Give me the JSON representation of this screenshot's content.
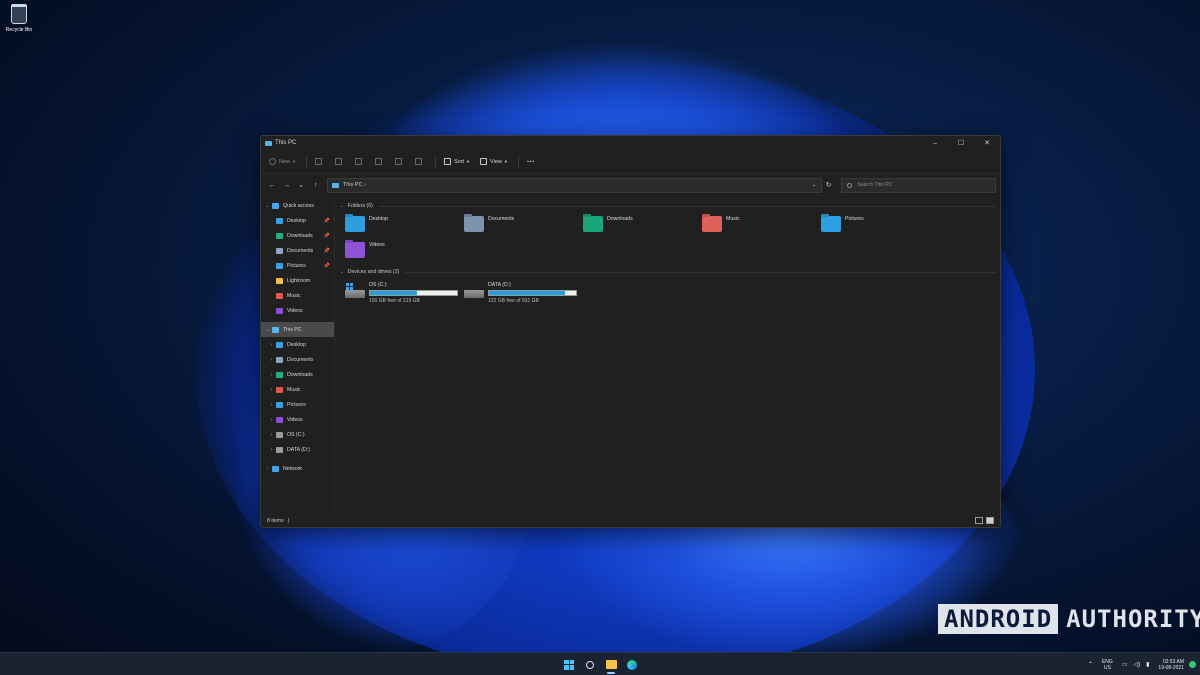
{
  "desktop": {
    "recycle_bin_label": "Recycle Bin",
    "watermark": {
      "part1": "ANDROID",
      "part2": "AUTHORITY"
    }
  },
  "window": {
    "title": "This PC",
    "controls": {
      "minimize": "–",
      "maximize": "☐",
      "close": "✕"
    }
  },
  "toolbar": {
    "new_label": "New",
    "sort_label": "Sort",
    "view_label": "View",
    "more_label": "···"
  },
  "address": {
    "back": "←",
    "forward": "→",
    "recent": "⌄",
    "up": "↑",
    "crumb": "This PC  ›",
    "dropdown": "⌄",
    "refresh": "↻",
    "search_placeholder": "Search This PC"
  },
  "sidebar": {
    "items": [
      {
        "label": "Quick access",
        "chev": "⌄",
        "color": "#4aa3e8",
        "pin": "",
        "icon": "star-icon",
        "indent": 0
      },
      {
        "label": "Desktop",
        "chev": "",
        "color": "#3aa0e0",
        "pin": "📌",
        "icon": "desktop-icon",
        "indent": 1
      },
      {
        "label": "Downloads",
        "chev": "",
        "color": "#1fb27a",
        "pin": "📌",
        "icon": "downloads-icon",
        "indent": 1
      },
      {
        "label": "Documents",
        "chev": "",
        "color": "#8fa4bf",
        "pin": "📌",
        "icon": "documents-icon",
        "indent": 1
      },
      {
        "label": "Pictures",
        "chev": "",
        "color": "#3aa0e0",
        "pin": "📌",
        "icon": "pictures-icon",
        "indent": 1
      },
      {
        "label": "Lightroom",
        "chev": "",
        "color": "#f0c04a",
        "pin": "",
        "icon": "folder-icon",
        "indent": 1
      },
      {
        "label": "Music",
        "chev": "",
        "color": "#e2574c",
        "pin": "",
        "icon": "music-icon",
        "indent": 1
      },
      {
        "label": "Videos",
        "chev": "",
        "color": "#8a4fd6",
        "pin": "",
        "icon": "videos-icon",
        "indent": 1
      },
      {
        "label": "This PC",
        "chev": "⌄",
        "color": "#5bb3e6",
        "pin": "",
        "icon": "this-pc-icon",
        "indent": 0
      },
      {
        "label": "Desktop",
        "chev": "›",
        "color": "#3aa0e0",
        "pin": "",
        "icon": "desktop-icon",
        "indent": 1
      },
      {
        "label": "Documents",
        "chev": "›",
        "color": "#8fa4bf",
        "pin": "",
        "icon": "documents-icon",
        "indent": 1
      },
      {
        "label": "Downloads",
        "chev": "›",
        "color": "#1fb27a",
        "pin": "",
        "icon": "downloads-icon",
        "indent": 1
      },
      {
        "label": "Music",
        "chev": "›",
        "color": "#e2574c",
        "pin": "",
        "icon": "music-icon",
        "indent": 1
      },
      {
        "label": "Pictures",
        "chev": "›",
        "color": "#3aa0e0",
        "pin": "",
        "icon": "pictures-icon",
        "indent": 1
      },
      {
        "label": "Videos",
        "chev": "›",
        "color": "#8a4fd6",
        "pin": "",
        "icon": "videos-icon",
        "indent": 1
      },
      {
        "label": "OS (C:)",
        "chev": "›",
        "color": "#9a9a9a",
        "pin": "",
        "icon": "drive-icon",
        "indent": 1
      },
      {
        "label": "DATA (D:)",
        "chev": "›",
        "color": "#9a9a9a",
        "pin": "",
        "icon": "drive-icon",
        "indent": 1
      },
      {
        "label": "Network",
        "chev": "›",
        "color": "#4aa3e8",
        "pin": "",
        "icon": "network-icon",
        "indent": 0
      }
    ],
    "selected_index": 8
  },
  "main": {
    "folders_header": "Folders (6)",
    "folders": [
      {
        "label": "Desktop",
        "color": "#2c9ee0",
        "icon": "desktop-folder-icon"
      },
      {
        "label": "Documents",
        "color": "#7f93ad",
        "icon": "documents-folder-icon"
      },
      {
        "label": "Downloads",
        "color": "#1aa67a",
        "icon": "downloads-folder-icon"
      },
      {
        "label": "Music",
        "color": "#e0605a",
        "icon": "music-folder-icon"
      },
      {
        "label": "Pictures",
        "color": "#2f9fe3",
        "icon": "pictures-folder-icon"
      },
      {
        "label": "Videos",
        "color": "#8e54d8",
        "icon": "videos-folder-icon"
      }
    ],
    "drives_header": "Devices and drives (2)",
    "drives": [
      {
        "label": "OS (C:)",
        "free_text": "100 GB free of 219 GB",
        "used_fraction": 0.54,
        "windows": true
      },
      {
        "label": "DATA (D:)",
        "free_text": "122 GB free of 931 GB",
        "used_fraction": 0.87,
        "windows": false
      }
    ]
  },
  "status": {
    "items_count": "8 items",
    "cursor": "|"
  },
  "taskbar": {
    "lang_top": "ENG",
    "lang_bottom": "US",
    "time": "02:53 AM",
    "date": "19-08-2021",
    "chevron": "⌃"
  }
}
